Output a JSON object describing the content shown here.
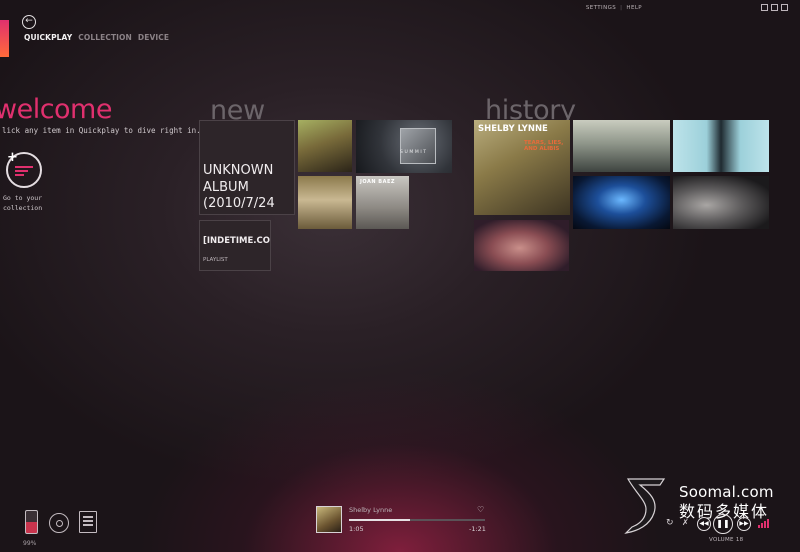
{
  "app": {
    "top_links": [
      "SETTINGS",
      "HELP"
    ],
    "nav_tabs": [
      {
        "label": "QUICKPLAY",
        "active": true
      },
      {
        "label": "COLLECTION",
        "active": false
      },
      {
        "label": "DEVICE",
        "active": false
      }
    ]
  },
  "welcome": {
    "title": "welcome",
    "description": "lick any item in Quickplay to dive right in.",
    "collection_link": "Go to your collection"
  },
  "new_section": {
    "title": "new",
    "album_tile": "UNKNOWN ALBUM (2010/7/24",
    "playlist_tile": {
      "title": "[INDETIME.CO SHELBY_LYNN",
      "type": "PLAYLIST"
    },
    "album_art_text": {
      "summit": "SUMMIT",
      "joan": "JOAN BAEZ"
    }
  },
  "history_section": {
    "title": "history",
    "featured_art_text": {
      "artist": "SHELBY LYNNE",
      "subtitle": "TEARS, LIES, AND ALIBIS"
    }
  },
  "status": {
    "battery": "99%"
  },
  "now_playing": {
    "artist": "Shelby Lynne",
    "elapsed": "1:05",
    "remaining": "-1:21",
    "progress": 0.45
  },
  "transport": {
    "volume_label": "VOLUME 18"
  },
  "watermark": {
    "line1": "Soomal.com",
    "line2": "数码多媒体"
  },
  "colors": {
    "accent": "#e0306e",
    "background": "#1b1418"
  },
  "icons": [
    "back-arrow-icon",
    "quickplay-add-icon",
    "phone-icon",
    "disc-icon",
    "list-icon",
    "heart-icon",
    "repeat-icon",
    "shuffle-icon",
    "previous-icon",
    "pause-icon",
    "next-icon",
    "volume-bars-icon"
  ]
}
